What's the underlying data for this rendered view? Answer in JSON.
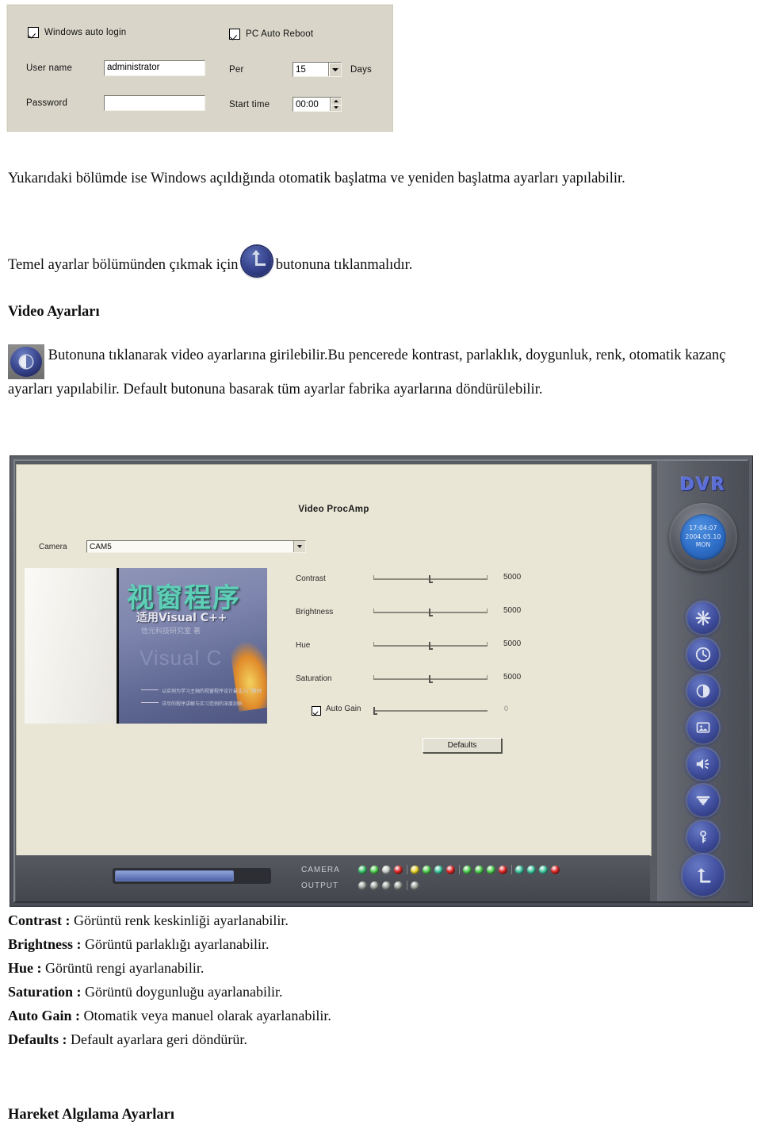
{
  "win_form": {
    "auto_login_checkbox_label": "Windows auto login",
    "auto_reboot_checkbox_label": "PC Auto Reboot",
    "username_label": "User name",
    "username_value": "administrator",
    "password_label": "Password",
    "password_value": "",
    "per_label": "Per",
    "per_value": "15",
    "days_label": "Days",
    "start_time_label": "Start time",
    "start_time_value": "00:00"
  },
  "doc": {
    "para1": "Yukarıdaki bölümde ise Windows açıldığında otomatik başlatma ve yeniden başlatma ayarları yapılabilir.",
    "para2_before": "Temel ayarlar bölümünden çıkmak için",
    "para2_after": "butonuna tıklanmalıdır.",
    "heading_video": "Video Ayarları",
    "para3": "Butonuna tıklanarak video ayarlarına girilebilir.Bu pencerede kontrast, parlaklık, doygunluk, renk, otomatik kazanç ayarları yapılabilir. Default butonuna basarak tüm ayarlar fabrika ayarlarına döndürülebilir.",
    "heading_motion": "Hareket Algılama Ayarları"
  },
  "dvr": {
    "logo": "DVR",
    "clock": {
      "time": "17:04:07",
      "date": "2004.05.10",
      "day": "MON"
    },
    "procamp_title": "Video ProcAmp",
    "camera_label": "Camera",
    "camera_value": "CAM5",
    "sliders": [
      {
        "label": "Contrast",
        "value": "5000",
        "thumb_pct": 50
      },
      {
        "label": "Brightness",
        "value": "5000",
        "thumb_pct": 50
      },
      {
        "label": "Hue",
        "value": "5000",
        "thumb_pct": 50
      },
      {
        "label": "Saturation",
        "value": "5000",
        "thumb_pct": 50
      }
    ],
    "auto_gain": {
      "label": "Auto Gain",
      "value": "0",
      "checked": true
    },
    "defaults_button": "Defaults",
    "preview": {
      "title_cn": "视窗程序",
      "subtitle_cn": "适用Visual C++",
      "author_cn": "信元科技研究室  著",
      "ghost_text": "Visual C",
      "bullet1": "以实例为学习主轴的视窗程序设计最佳入门教材",
      "bullet2": "详尽的程序讲解与实习范例的深度剖析"
    },
    "bottom": {
      "camera_label": "CAMERA",
      "output_label": "OUTPUT",
      "camera_leds": [
        "#38c46a",
        "#4fd14f",
        "#c9cdc9",
        "#e02424",
        "#e8d32a",
        "#4fd14f",
        "#3fc9a0",
        "#e02424",
        "#4fd14f",
        "#4fd14f",
        "#4fd14f",
        "#e02424",
        "#3fc9a0",
        "#3fc9a0",
        "#3fc9a0",
        "#e02424"
      ],
      "output_leds": [
        "#9aa09a",
        "#9aa09a",
        "#9aa09a",
        "#9aa09a",
        "#9aa09a"
      ]
    },
    "side_buttons": [
      "gear-icon",
      "clock-icon",
      "contrast-icon",
      "image-icon",
      "speaker-icon",
      "dome-camera-icon",
      "key-icon",
      "exit-icon"
    ]
  },
  "definitions": [
    {
      "term": "Contrast :",
      "desc": "Görüntü renk keskinliği ayarlanabilir."
    },
    {
      "term": "Brightness :",
      "desc": "Görüntü parlaklığı ayarlanabilir."
    },
    {
      "term": "Hue :",
      "desc": "Görüntü rengi ayarlanabilir."
    },
    {
      "term": "Saturation :",
      "desc": "Görüntü doygunluğu ayarlanabilir."
    },
    {
      "term": "Auto Gain :",
      "desc": "Otomatik veya manuel olarak ayarlanabilir."
    },
    {
      "term": "Defaults :",
      "desc": "Default ayarlara geri döndürür."
    }
  ],
  "colors": {
    "dvr_logo": "#5b6fd8",
    "dvr_panel": "#5a5d65",
    "screen_bg": "#e9e6d6",
    "button_blue": "#3f4d9c"
  }
}
